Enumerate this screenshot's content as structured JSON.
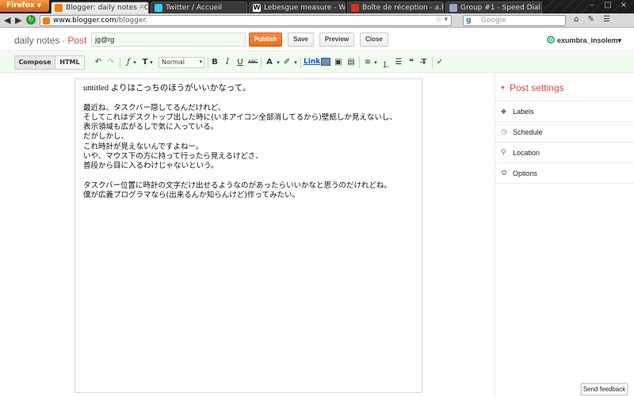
{
  "browser": {
    "menu_label": "Firefox",
    "tabs": [
      {
        "label": "Blogger: daily notes - Cr...",
        "color": "#f57d00",
        "active": true
      },
      {
        "label": "Twitter / Accueil",
        "color": "#33ccff",
        "active": false
      },
      {
        "label": "Lebesgue measure - Wi...",
        "color": "#ffffff",
        "active": false
      },
      {
        "label": "Boîte de réception - a.h...",
        "color": "#d93025",
        "active": false
      },
      {
        "label": "Group #1 - Speed Dial",
        "color": "#9aa7c4",
        "active": false
      }
    ],
    "url_host": "www.blogger.com",
    "url_path": "/blogger.",
    "search_engine": "Google",
    "search_icon_label": "g"
  },
  "blogger": {
    "blog_name": "daily notes",
    "separator": "·",
    "section": "Post",
    "post_title": "jg@rg",
    "buttons": {
      "publish": "Publish",
      "save": "Save",
      "preview": "Preview",
      "close": "Close"
    },
    "user": "exumbra_insolem▾"
  },
  "toolbar": {
    "compose": "Compose",
    "html": "HTML",
    "format": "Normal",
    "bold": "B",
    "italic": "I",
    "underline": "U",
    "strike": "ABC",
    "text_color": "A",
    "link": "Link",
    "font_icon": "ƒ",
    "size_icon": "T"
  },
  "editor": {
    "lines": [
      "untitled よりはこっちのほうがいいかなって。",
      "",
      "最近ね、タスクバー隠してるんだけれど、",
      "そしてこれはデスクトップ出した時に(いまアイコン全部消してるから)壁紙しか見えないし、",
      "表示領域も広がるしで気に入っている。",
      "だがしかし、",
      "これ時計が見えないんですよねー。",
      "いや、マウス下の方に持って行ったら見えるけどさ、",
      "普段から目に入るわけじゃないという。",
      "",
      "タスクバー位置に時計の文字だけ出せるようなのがあったらいいかなと思うのだけれどね。",
      "僕が広義プログラマなら(出来るんか知らんけど)作ってみたい。"
    ]
  },
  "post_settings": {
    "title": "Post settings",
    "items": [
      {
        "label": "Labels",
        "icon": "tag-icon"
      },
      {
        "label": "Schedule",
        "icon": "clock-icon"
      },
      {
        "label": "Location",
        "icon": "pin-icon"
      },
      {
        "label": "Options",
        "icon": "gear-icon"
      }
    ]
  },
  "feedback": "Send feedback",
  "colors": {
    "accent": "#dd4b39",
    "publish": "#f58a3a",
    "toolbar_bg": "#f0fcef"
  }
}
